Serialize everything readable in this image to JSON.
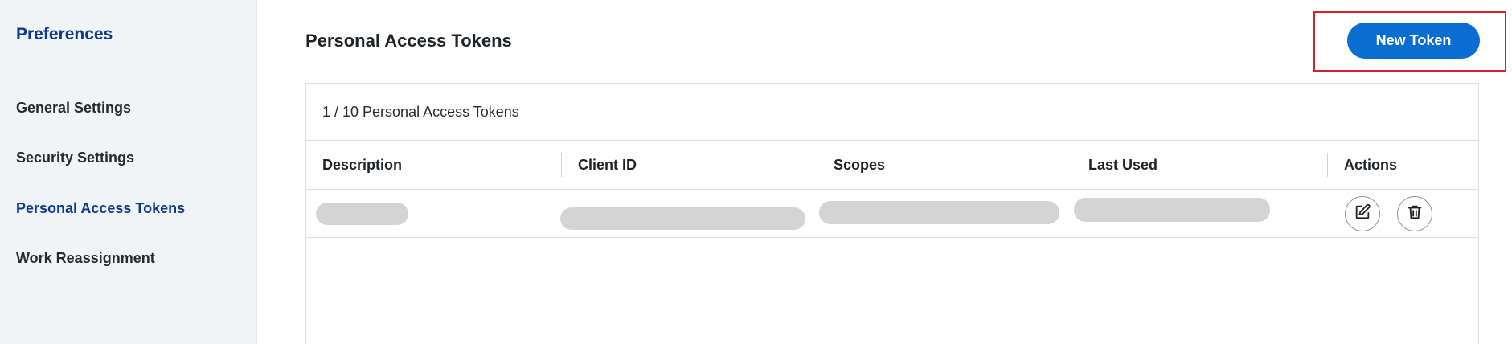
{
  "sidebar": {
    "title": "Preferences",
    "items": [
      {
        "label": "General Settings",
        "active": false
      },
      {
        "label": "Security Settings",
        "active": false
      },
      {
        "label": "Personal Access Tokens",
        "active": true
      },
      {
        "label": "Work Reassignment",
        "active": false
      }
    ]
  },
  "main": {
    "title": "Personal Access Tokens",
    "new_token_label": "New Token",
    "count_text": "1 / 10 Personal Access Tokens"
  },
  "table": {
    "columns": [
      "Description",
      "Client ID",
      "Scopes",
      "Last Used",
      "Actions"
    ],
    "rows": [
      {
        "description": "[redacted]",
        "client_id": "[redacted]",
        "scopes": "[redacted]",
        "last_used": "[redacted]",
        "actions": [
          "edit-icon",
          "trash-icon"
        ]
      }
    ]
  },
  "colors": {
    "brand_blue": "#0a6ed1",
    "nav_active": "#0e3a8c",
    "sidebar_bg": "#f1f4f7",
    "highlight": "#d3202a",
    "redaction": "#d4d4d4"
  }
}
